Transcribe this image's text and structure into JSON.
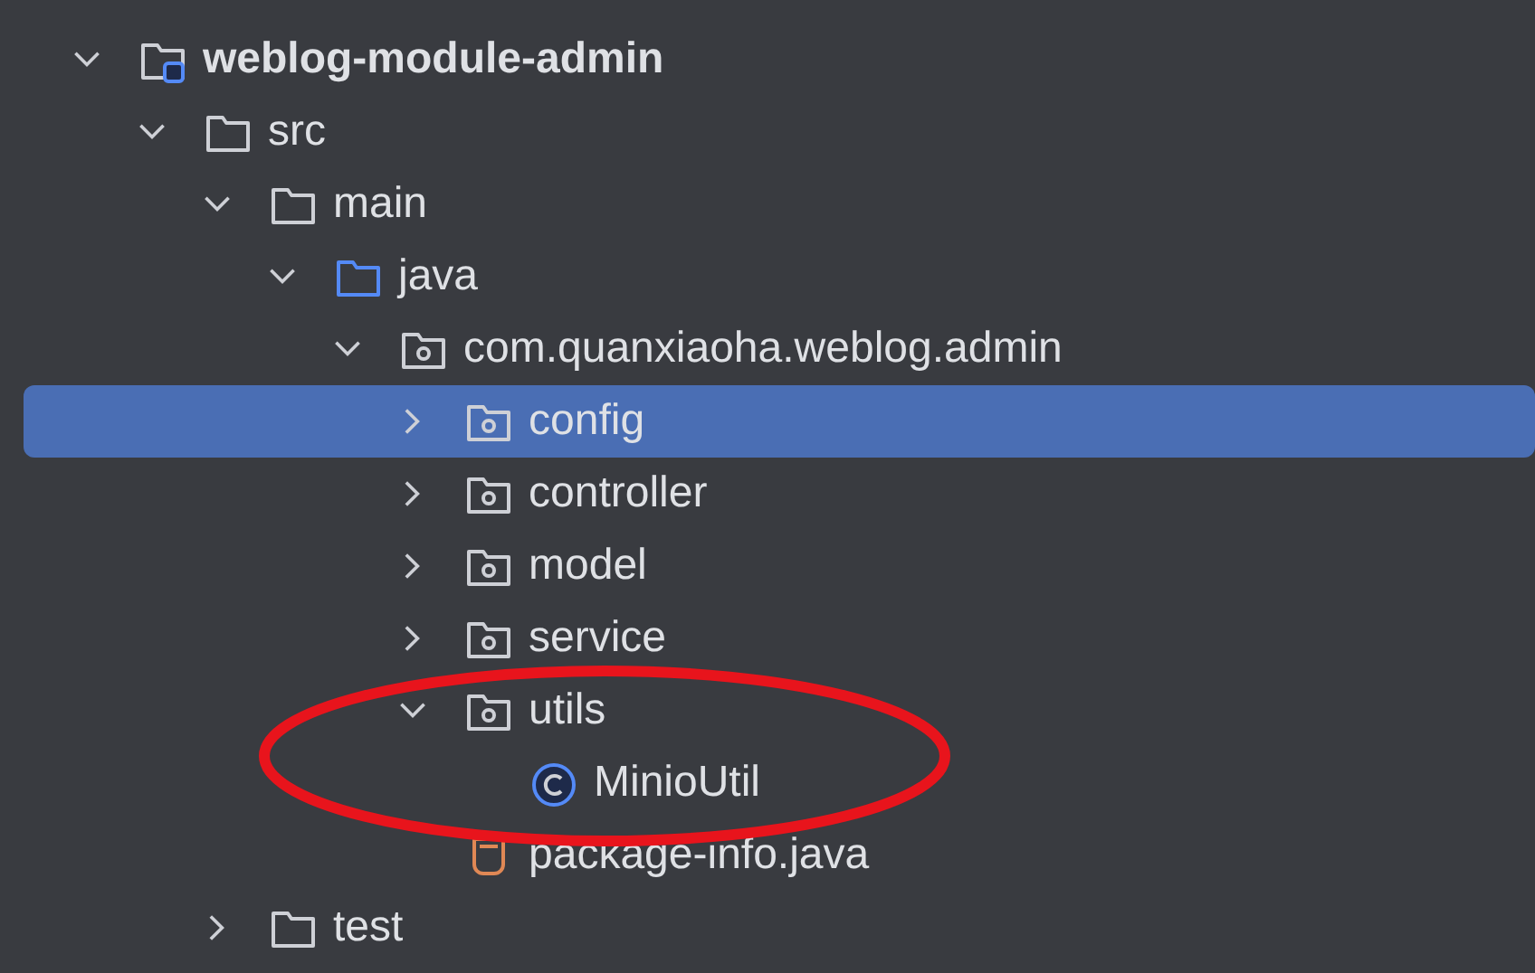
{
  "tree": [
    {
      "label": "weblog-module-admin",
      "kind": "module",
      "expanded": true,
      "selected": false,
      "children": [
        {
          "label": "src",
          "kind": "folder",
          "expanded": true,
          "selected": false,
          "children": [
            {
              "label": "main",
              "kind": "folder",
              "expanded": true,
              "selected": false,
              "children": [
                {
                  "label": "java",
                  "kind": "source-folder",
                  "expanded": true,
                  "selected": false,
                  "children": [
                    {
                      "label": "com.quanxiaoha.weblog.admin",
                      "kind": "package",
                      "expanded": true,
                      "selected": false,
                      "children": [
                        {
                          "label": "config",
                          "kind": "package",
                          "expanded": false,
                          "selected": true
                        },
                        {
                          "label": "controller",
                          "kind": "package",
                          "expanded": false,
                          "selected": false
                        },
                        {
                          "label": "model",
                          "kind": "package",
                          "expanded": false,
                          "selected": false
                        },
                        {
                          "label": "service",
                          "kind": "package",
                          "expanded": false,
                          "selected": false
                        },
                        {
                          "label": "utils",
                          "kind": "package",
                          "expanded": true,
                          "selected": false,
                          "children": [
                            {
                              "label": "MinioUtil",
                              "kind": "class",
                              "selected": false
                            }
                          ]
                        },
                        {
                          "label": "package-info.java",
                          "kind": "java-file",
                          "selected": false
                        }
                      ]
                    }
                  ]
                }
              ]
            },
            {
              "label": "test",
              "kind": "folder",
              "expanded": false,
              "selected": false
            }
          ]
        }
      ]
    }
  ],
  "annotation": {
    "kind": "ellipse"
  }
}
